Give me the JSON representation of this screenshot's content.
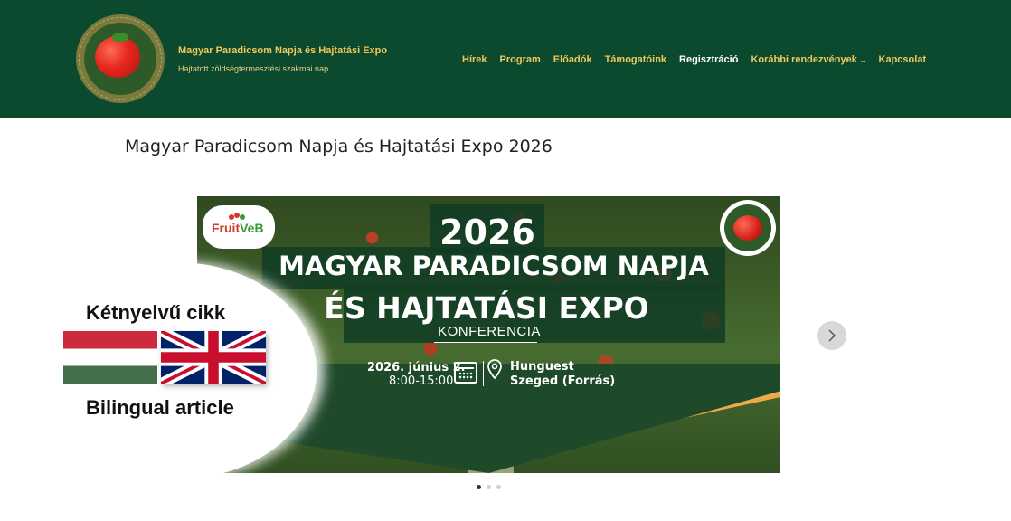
{
  "header": {
    "site_title": "Magyar Paradicsom Napja és Hajtatási Expo",
    "tagline": "Hajtatott zöldségtermesztési szakmai nap",
    "logo_text": "MAGYAR PARADICSOM NAPJA",
    "bg_color": "#0b4a2e",
    "nav_color": "#f1c85a"
  },
  "nav": {
    "items": [
      {
        "label": "Hírek"
      },
      {
        "label": "Program"
      },
      {
        "label": "Előadók"
      },
      {
        "label": "Támogatóink"
      },
      {
        "label": "Regisztráció"
      },
      {
        "label": "Korábbi rendezvények"
      },
      {
        "label": "Kapcsolat"
      }
    ]
  },
  "page": {
    "title": "Magyar Paradicsom Napja és Hajtatási Expo 2026"
  },
  "slide": {
    "year": "2026",
    "title_line1": "MAGYAR PARADICSOM NAPJA",
    "title_line2": "ÉS HAJTATÁSI EXPO",
    "subtitle": "KONFERENCIA",
    "date": "2026. június 2.",
    "time": "8:00-15:00",
    "venue_line1": "Hunguest",
    "venue_line2": "Szeged (Forrás)",
    "sponsor_logo_text": "Fruit",
    "sponsor_logo_text2": "VeB",
    "bilingual_label_hu": "Kétnyelvű cikk",
    "bilingual_label_en": "Bilingual article"
  },
  "slider": {
    "slide_count": 3,
    "active_index": 0
  }
}
